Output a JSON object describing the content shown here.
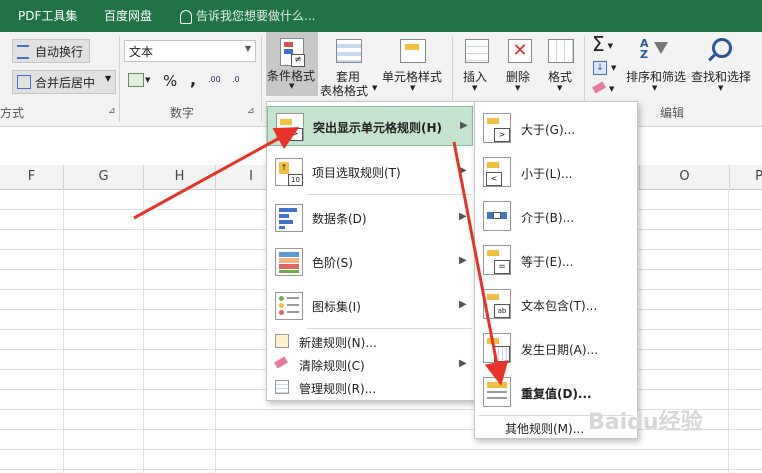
{
  "tabs": {
    "pdf_tools": "PDF工具集",
    "baidu_disk": "百度网盘",
    "tell_me": "告诉我您想要做什么..."
  },
  "ribbon": {
    "wrap_text": "自动换行",
    "merge_center": "合并后居中",
    "alignment_group_partial": "方式",
    "number_format": "文本",
    "percent": "%",
    "comma": ",",
    "dec_increase": ".00",
    "dec_decrease": ".0",
    "number_group": "数字",
    "conditional_format": "条件格式",
    "table_format_1": "套用",
    "table_format_2": "表格格式",
    "cell_styles": "单元格样式",
    "insert": "插入",
    "delete": "删除",
    "format": "格式",
    "sort_filter": "排序和筛选",
    "find_select": "查找和选择",
    "editing_group": "编辑"
  },
  "columns": [
    "F",
    "G",
    "H",
    "I",
    "O",
    "P"
  ],
  "cf_menu": {
    "items": [
      {
        "label": "突出显示单元格规则(H)"
      },
      {
        "label": "项目选取规则(T)"
      },
      {
        "label": "数据条(D)"
      },
      {
        "label": "色阶(S)"
      },
      {
        "label": "图标集(I)"
      },
      {
        "label": "新建规则(N)..."
      },
      {
        "label": "清除规则(C)"
      },
      {
        "label": "管理规则(R)..."
      }
    ]
  },
  "highlight_menu": {
    "items": [
      {
        "label": "大于(G)..."
      },
      {
        "label": "小于(L)..."
      },
      {
        "label": "介于(B)..."
      },
      {
        "label": "等于(E)..."
      },
      {
        "label": "文本包含(T)..."
      },
      {
        "label": "发生日期(A)..."
      },
      {
        "label": "重复值(D)..."
      },
      {
        "label": "其他规则(M)..."
      }
    ]
  },
  "colors": {
    "ribbon_tab_bar": "#217346",
    "menu_highlight": "#c5e3cf",
    "annotation_arrow": "#e8322a"
  },
  "watermark": {
    "text": "Baidu经验"
  }
}
